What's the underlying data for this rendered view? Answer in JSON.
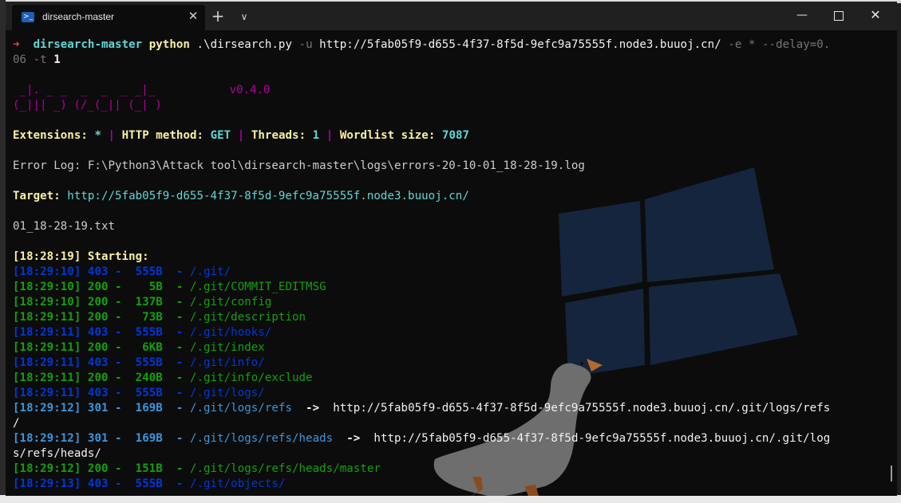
{
  "window": {
    "tab_title": "dirsearch-master",
    "tab_icon": "powershell-icon",
    "tab_close": "✕",
    "new_tab": "+",
    "dropdown": "⌵",
    "minimize": "—",
    "close": "✕"
  },
  "terminal": {
    "prompt": {
      "arrow": "➜",
      "dir": "dirsearch-master",
      "cmd": "python",
      "script": ".\\dirsearch.py",
      "flag_u": "-u",
      "url": "http://5fab05f9-d655-4f37-8f5d-9efc9a75555f.node3.buuoj.cn/",
      "flag_e": "-e",
      "ext": "*",
      "delay_part1": "--delay=0.",
      "delay_part2": "06",
      "flag_t": "-t",
      "threads": "1"
    },
    "logo_line1": " _|. _ _  _  _  _ _|_",
    "logo_line2": "(_||| _) (/_(_|| (_| )",
    "version": "v0.4.0",
    "info": {
      "ext_label": "Extensions:",
      "ext_value": "*",
      "method_label": "HTTP method:",
      "method_value": "GET",
      "threads_label": "Threads:",
      "threads_value": "1",
      "wordlist_label": "Wordlist size:",
      "wordlist_value": "7087",
      "sep": "|"
    },
    "error_log": "Error Log: F:\\Python3\\Attack tool\\dirsearch-master\\logs\\errors-20-10-01_18-28-19.log",
    "target_label": "Target:",
    "target_url": "http://5fab05f9-d655-4f37-8f5d-9efc9a75555f.node3.buuoj.cn/",
    "report_file": "01_18-28-19.txt",
    "starting": "[18:28:19] Starting:",
    "results": [
      {
        "time": "[18:29:10]",
        "status": "403",
        "size": "555B",
        "path": "/.git/",
        "redirect": "",
        "color": "blue"
      },
      {
        "time": "[18:29:10]",
        "status": "200",
        "size": "5B",
        "path": "/.git/COMMIT_EDITMSG",
        "redirect": "",
        "color": "green"
      },
      {
        "time": "[18:29:10]",
        "status": "200",
        "size": "137B",
        "path": "/.git/config",
        "redirect": "",
        "color": "green"
      },
      {
        "time": "[18:29:11]",
        "status": "200",
        "size": "73B",
        "path": "/.git/description",
        "redirect": "",
        "color": "green"
      },
      {
        "time": "[18:29:11]",
        "status": "403",
        "size": "555B",
        "path": "/.git/hooks/",
        "redirect": "",
        "color": "blue"
      },
      {
        "time": "[18:29:11]",
        "status": "200",
        "size": "6KB",
        "path": "/.git/index",
        "redirect": "",
        "color": "green"
      },
      {
        "time": "[18:29:11]",
        "status": "403",
        "size": "555B",
        "path": "/.git/info/",
        "redirect": "",
        "color": "blue"
      },
      {
        "time": "[18:29:11]",
        "status": "200",
        "size": "240B",
        "path": "/.git/info/exclude",
        "redirect": "",
        "color": "green"
      },
      {
        "time": "[18:29:11]",
        "status": "403",
        "size": "555B",
        "path": "/.git/logs/",
        "redirect": "",
        "color": "blue"
      },
      {
        "time": "[18:29:12]",
        "status": "301",
        "size": "169B",
        "path": "/.git/logs/refs",
        "redirect": "http://5fab05f9-d655-4f37-8f5d-9efc9a75555f.node3.buuoj.cn/.git/logs/refs",
        "wrap": "/",
        "color": "cyan"
      },
      {
        "time": "[18:29:12]",
        "status": "301",
        "size": "169B",
        "path": "/.git/logs/refs/heads",
        "redirect": "http://5fab05f9-d655-4f37-8f5d-9efc9a75555f.node3.buuoj.cn/.git/log",
        "wrap": "s/refs/heads/",
        "color": "cyan"
      },
      {
        "time": "[18:29:12]",
        "status": "200",
        "size": "151B",
        "path": "/.git/logs/refs/heads/master",
        "redirect": "",
        "color": "green"
      },
      {
        "time": "[18:29:13]",
        "status": "403",
        "size": "555B",
        "path": "/.git/objects/",
        "redirect": "",
        "color": "blue"
      }
    ]
  }
}
